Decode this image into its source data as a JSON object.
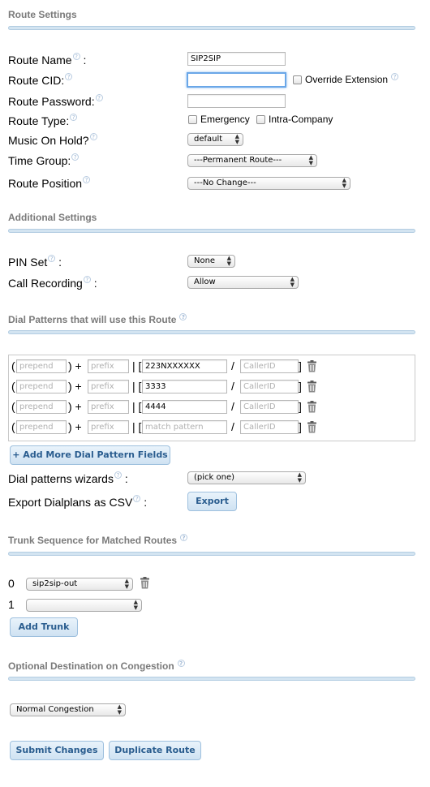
{
  "route_settings": {
    "title": "Route Settings",
    "name_label": "Route Name",
    "name_suffix": ":",
    "name_value": "SIP2SIP",
    "cid_label": "Route CID:",
    "cid_value": "",
    "override_label": "Override Extension",
    "password_label": "Route Password:",
    "password_value": "",
    "type_label": "Route Type:",
    "emergency_label": "Emergency",
    "intra_label": "Intra-Company",
    "moh_label": "Music On Hold?",
    "moh_value": "default",
    "time_group_label": "Time Group:",
    "time_group_value": "---Permanent Route---",
    "position_label": "Route Position",
    "position_value": "---No Change---"
  },
  "additional": {
    "title": "Additional Settings",
    "pin_label": "PIN Set",
    "pin_suffix": ":",
    "pin_value": "None",
    "recording_label": "Call Recording",
    "recording_suffix": ":",
    "recording_value": "Allow"
  },
  "dial_patterns": {
    "title": "Dial Patterns that will use this Route",
    "placeholders": {
      "prepend": "prepend",
      "prefix": "prefix",
      "match": "match pattern",
      "callerid": "CallerID"
    },
    "rows": [
      {
        "prepend": "",
        "prefix": "",
        "match": "223NXXXXXX",
        "callerid": ""
      },
      {
        "prepend": "",
        "prefix": "",
        "match": "3333",
        "callerid": ""
      },
      {
        "prepend": "",
        "prefix": "",
        "match": "4444",
        "callerid": ""
      },
      {
        "prepend": "",
        "prefix": "",
        "match": "",
        "callerid": ""
      }
    ],
    "add_more_label": "+ Add More Dial Pattern Fields",
    "wizards_label": "Dial patterns wizards",
    "wizards_suffix": ":",
    "wizards_value": "(pick one)",
    "export_label": "Export Dialplans as CSV",
    "export_suffix": ":",
    "export_button": "Export"
  },
  "trunks": {
    "title": "Trunk Sequence for Matched Routes",
    "rows": [
      {
        "index": "0",
        "value": "sip2sip-out"
      },
      {
        "index": "1",
        "value": ""
      }
    ],
    "add_trunk_label": "Add Trunk"
  },
  "congestion": {
    "title": "Optional Destination on Congestion",
    "value": "Normal Congestion"
  },
  "actions": {
    "submit_label": "Submit Changes",
    "duplicate_label": "Duplicate Route"
  },
  "colors": {
    "section_rule": "#d3e4f1",
    "button_text": "#2a5d8f",
    "section_title": "#7a7a7a"
  },
  "icons": {
    "help": "help-icon",
    "delete": "trash-icon"
  }
}
